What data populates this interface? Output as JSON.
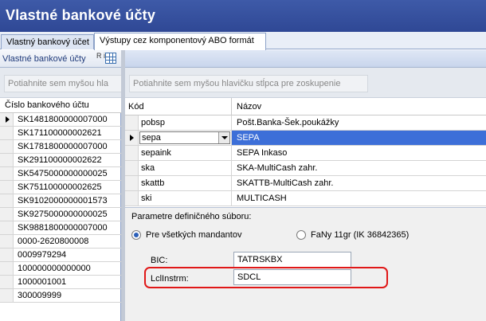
{
  "window": {
    "title": "Vlastné bankové účty"
  },
  "tabs": [
    {
      "label": "Vlastný bankový účet"
    },
    {
      "label": "Výstupy cez komponentový ABO formát"
    }
  ],
  "left_panel": {
    "header": "Vlastné bankové účty",
    "header_icon_text": "R\ni",
    "group_hint": "Potiahnite sem myšou hla",
    "column": "Číslo bankového účtu",
    "rows": [
      "SK1481800000007000",
      "SK171100000002621",
      "SK1781800000007000",
      "SK291100000002622",
      "SK5475000000000025",
      "SK751100000002625",
      "SK9102000000001573",
      "SK9275000000000025",
      "SK9881800000007000",
      "0000-2620800008",
      "0009979294",
      "100000000000000",
      "1000001001",
      "300009999"
    ]
  },
  "right_panel": {
    "group_hint": "Potiahnite sem myšou hlavičku stĺpca pre zoskupenie",
    "columns": {
      "code": "Kód",
      "name": "Názov"
    },
    "rows": [
      {
        "code": "pobsp",
        "name": "Pošt.Banka-Šek.poukážky"
      },
      {
        "code": "sepa",
        "name": "SEPA"
      },
      {
        "code": "sepaink",
        "name": "SEPA Inkaso"
      },
      {
        "code": "ska",
        "name": "SKA-MultiCash zahr."
      },
      {
        "code": "skattb",
        "name": "SKATTB-MultiCash zahr."
      },
      {
        "code": "ski",
        "name": "MULTICASH"
      }
    ]
  },
  "params": {
    "title": "Parametre definičného súboru:",
    "radio_all": "Pre všetkých mandantov",
    "radio_company": "FaNy 11gr (IK 36842365)",
    "bic_label": "BIC:",
    "bic_value": "TATRSKBX",
    "lclinstrm_label": "LclInstrm:",
    "lclinstrm_value": "SDCL"
  },
  "colors": {
    "title_bar": "#3e5aa8",
    "selection": "#3d6fd8",
    "highlight": "#e01818"
  }
}
